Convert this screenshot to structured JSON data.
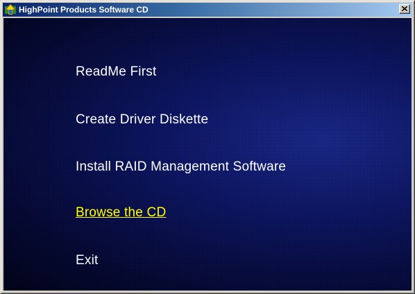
{
  "window": {
    "title": "HighPoint Products Software CD",
    "app_icon": "highpoint-logo-icon",
    "close_icon": "close-x-icon"
  },
  "menu": {
    "items": [
      {
        "label": "ReadMe First",
        "active": false
      },
      {
        "label": "Create Driver Diskette",
        "active": false
      },
      {
        "label": "Install RAID Management Software",
        "active": false
      },
      {
        "label": "Browse the CD",
        "active": true
      },
      {
        "label": "Exit",
        "active": false
      }
    ]
  },
  "colors": {
    "background": "#0a1260",
    "text": "#ffffff",
    "highlight": "#ffff00"
  }
}
